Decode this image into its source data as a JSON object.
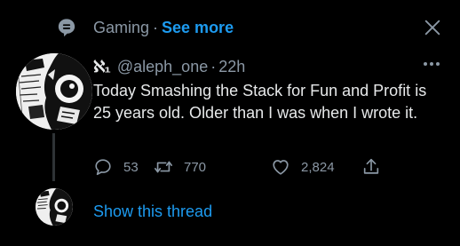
{
  "topic": {
    "icon": "topic-icon",
    "name": "Gaming",
    "separator": "·",
    "see_more_label": "See more",
    "dismiss_icon": "close-icon"
  },
  "tweet": {
    "display_name": "ℵ₁",
    "handle": "@aleph_one",
    "separator": "·",
    "time_ago": "22h",
    "text": "Today Smashing the Stack for Fun and Profit is 25 years old. Older than I was when I wrote it.",
    "actions": {
      "replies": "53",
      "retweets": "770",
      "likes": "2,824"
    },
    "avatar_text": "PHRACK"
  },
  "thread": {
    "show_thread_label": "Show this thread"
  },
  "colors": {
    "background": "#000000",
    "text_primary": "#e7e9ea",
    "text_secondary": "#8b98a5",
    "accent": "#1d9bf0"
  }
}
